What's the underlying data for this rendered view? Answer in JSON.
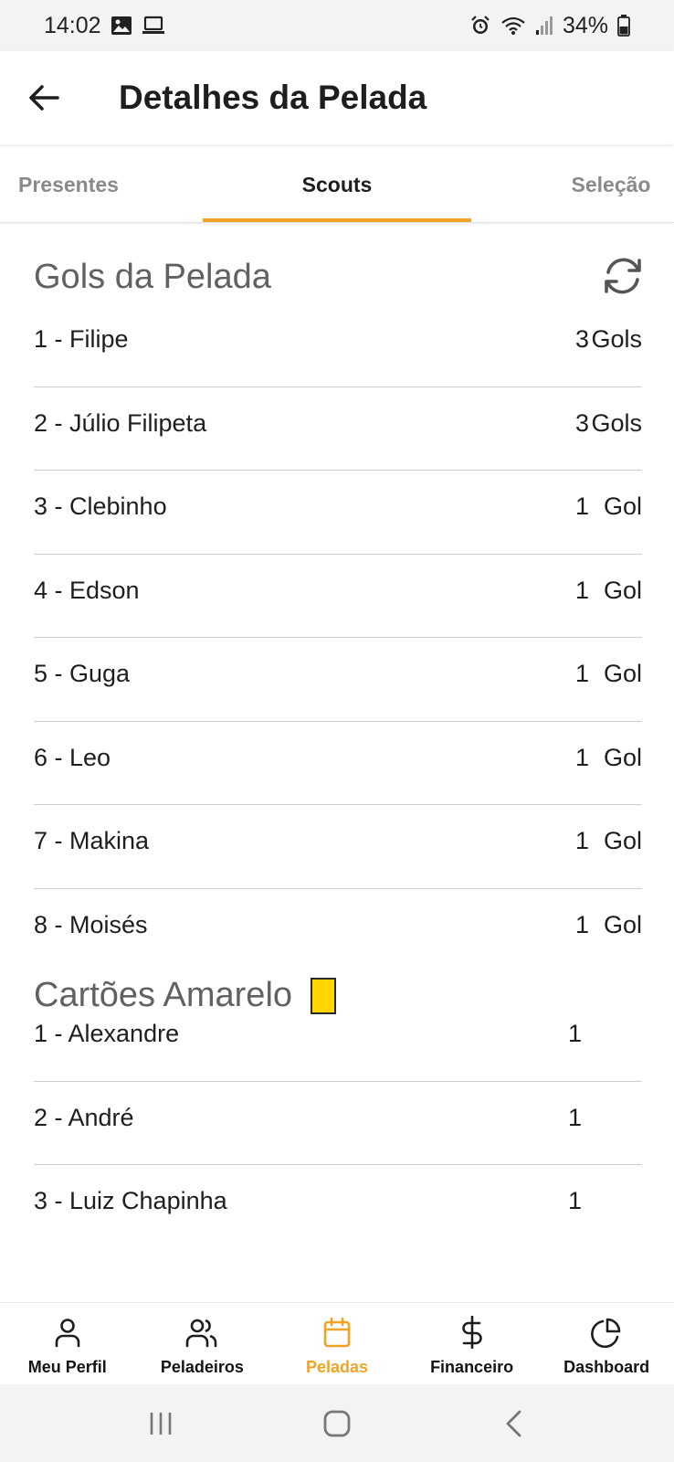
{
  "status_bar": {
    "time": "14:02",
    "battery": "34%",
    "left_icons": [
      "image-icon",
      "laptop-icon"
    ],
    "right_icons": [
      "alarm-icon",
      "wifi-icon",
      "signal-icon",
      "battery-icon"
    ]
  },
  "app_bar": {
    "title": "Detalhes da Pelada",
    "back_icon": "arrow-left-icon"
  },
  "tabs": {
    "items": [
      {
        "label": "Presentes"
      },
      {
        "label": "Scouts"
      },
      {
        "label": "Seleção"
      }
    ],
    "active": "Scouts",
    "accent": "#f1a325"
  },
  "goals": {
    "title": "Gols da Pelada",
    "refresh_icon": "refresh-icon",
    "items": [
      {
        "name": "1 - Filipe",
        "count": "3",
        "unit": "Gols"
      },
      {
        "name": "2 - Júlio Filipeta",
        "count": "3",
        "unit": "Gols"
      },
      {
        "name": "3 - Clebinho",
        "count": "1",
        "unit": "Gol"
      },
      {
        "name": "4 - Edson",
        "count": "1",
        "unit": "Gol"
      },
      {
        "name": "5 - Guga",
        "count": "1",
        "unit": "Gol"
      },
      {
        "name": "6 - Leo",
        "count": "1",
        "unit": "Gol"
      },
      {
        "name": "7 - Makina",
        "count": "1",
        "unit": "Gol"
      },
      {
        "name": "8 - Moisés",
        "count": "1",
        "unit": "Gol"
      }
    ]
  },
  "yellow_cards": {
    "title": "Cartões Amarelo",
    "card_color": "#ffd600",
    "items": [
      {
        "name": "1 - Alexandre",
        "count": "1"
      },
      {
        "name": "2 - André",
        "count": "1"
      },
      {
        "name": "3 - Luiz Chapinha",
        "count": "1"
      }
    ]
  },
  "bottom_nav": {
    "items": [
      {
        "label": "Meu Perfil",
        "icon": "user-icon"
      },
      {
        "label": "Peladeiros",
        "icon": "users-icon"
      },
      {
        "label": "Peladas",
        "icon": "calendar-icon"
      },
      {
        "label": "Financeiro",
        "icon": "dollar-icon"
      },
      {
        "label": "Dashboard",
        "icon": "pie-chart-icon"
      }
    ],
    "active": "Peladas",
    "accent": "#f1a325"
  },
  "system_nav": [
    "recents-icon",
    "home-icon",
    "back-icon"
  ]
}
